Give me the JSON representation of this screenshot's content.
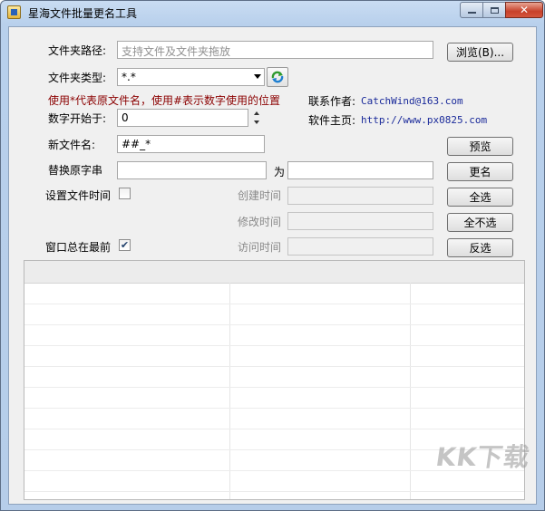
{
  "window": {
    "title": "星海文件批量更名工具"
  },
  "form": {
    "folder_path_label": "文件夹路径:",
    "folder_path_placeholder": "支持文件及文件夹拖放",
    "browse_label": "浏览(B)...",
    "folder_type_label": "文件夹类型:",
    "folder_type_value": "*.*",
    "hint": "使用*代表原文件名，使用#表示数字使用的位置",
    "contact_label": "联系作者:",
    "contact_value": "CatchWind@163.com",
    "homepage_label": "软件主页:",
    "homepage_value": "http://www.px0825.com",
    "start_number_label": "数字开始于:",
    "start_number_value": "0",
    "new_name_label": "新文件名:",
    "new_name_value": "##_*",
    "replace_label": "替换原字串",
    "replace_value": "",
    "replace_with_label": "为",
    "replace_with_value": "",
    "set_time_label": "设置文件时间",
    "set_time_checked": false,
    "created_label": "创建时间",
    "modified_label": "修改时间",
    "accessed_label": "访问时间",
    "always_on_top_label": "窗口总在最前",
    "always_on_top_checked": true
  },
  "buttons": {
    "preview": "预览",
    "rename": "更名",
    "select_all": "全选",
    "select_none": "全不选",
    "invert": "反选"
  },
  "watermark": "KK下载"
}
